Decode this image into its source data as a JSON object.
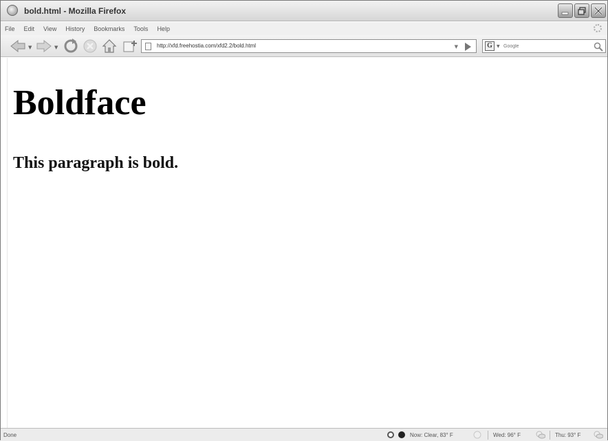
{
  "window": {
    "title": "bold.html - Mozilla Firefox"
  },
  "menu": {
    "items": [
      "File",
      "Edit",
      "View",
      "History",
      "Bookmarks",
      "Tools",
      "Help"
    ]
  },
  "toolbar": {
    "url": "http://xfd.freehostia.com/xfd2.2/bold.html",
    "search_placeholder": "Google",
    "search_engine_glyph": "G"
  },
  "page": {
    "heading": "Boldface",
    "paragraph": "This paragraph is bold."
  },
  "status": {
    "text": "Done",
    "weather_now": "Now: Clear, 83° F",
    "weather_wed": "Wed: 96° F",
    "weather_thu": "Thu: 93° F"
  }
}
